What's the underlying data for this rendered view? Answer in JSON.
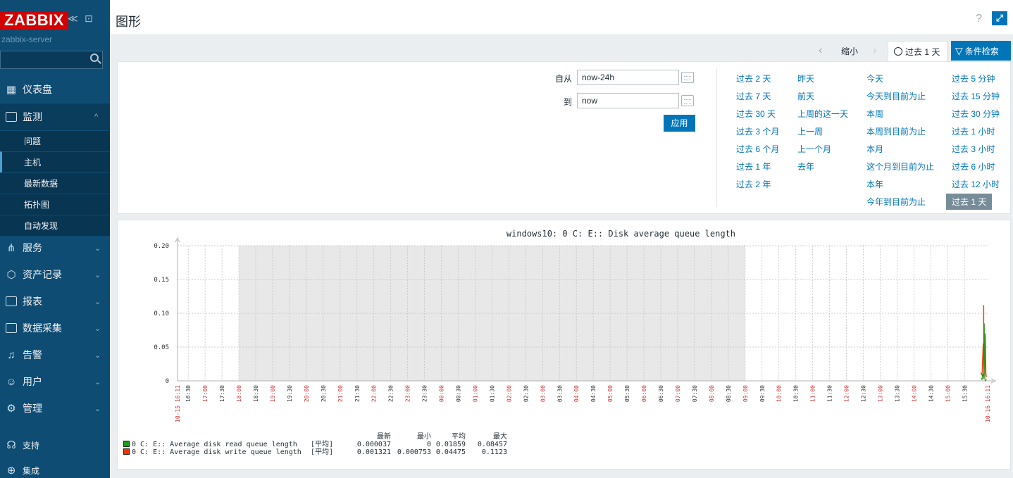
{
  "app": {
    "logo": "ZABBIX",
    "server": "zabbix-server"
  },
  "sidebar": {
    "menu": [
      {
        "label": "仪表盘",
        "icon": "dashboard-icon"
      },
      {
        "label": "监测",
        "icon": "monitor-icon"
      },
      {
        "label": "服务",
        "icon": "services-icon"
      },
      {
        "label": "资产记录",
        "icon": "inventory-icon"
      },
      {
        "label": "报表",
        "icon": "reports-icon"
      },
      {
        "label": "数据采集",
        "icon": "data-collection-icon"
      },
      {
        "label": "告警",
        "icon": "alerts-icon"
      },
      {
        "label": "用户",
        "icon": "users-icon"
      },
      {
        "label": "管理",
        "icon": "administration-icon"
      }
    ],
    "submenu": [
      "问题",
      "主机",
      "最新数据",
      "拓扑图",
      "自动发现"
    ],
    "support": "支持",
    "integrations": "集成"
  },
  "header": {
    "title": "图形",
    "help": "?"
  },
  "timebar": {
    "zoom_out": "缩小",
    "period_tab": "过去 1 天",
    "filter_tab": "条件检索"
  },
  "filter": {
    "from_label": "自从",
    "from_value": "now-24h",
    "to_label": "到",
    "to_value": "now",
    "apply": "应用",
    "quick": [
      [
        "过去 2 天",
        "过去 7 天",
        "过去 30 天",
        "过去 3 个月",
        "过去 6 个月",
        "过去 1 年",
        "过去 2 年"
      ],
      [
        "昨天",
        "前天",
        "上周的这一天",
        "上一周",
        "上一个月",
        "去年"
      ],
      [
        "今天",
        "今天到目前为止",
        "本周",
        "本周到目前为止",
        "本月",
        "这个月到目前为止",
        "本年",
        "今年到目前为止"
      ],
      [
        "过去 5 分钟",
        "过去 15 分钟",
        "过去 30 分钟",
        "过去 1 小时",
        "过去 3 小时",
        "过去 6 小时",
        "过去 12 小时",
        "过去 1 天"
      ]
    ],
    "selected": "过去 1 天"
  },
  "chart_data": {
    "type": "line",
    "title": "windows10: 0 C: E:: Disk average queue length",
    "ylim": [
      0,
      0.2
    ],
    "yticks": [
      "0",
      "0.05",
      "0.10",
      "0.15",
      "0.20"
    ],
    "x_start_label": "10-15 16:11",
    "x_end_label": "10-16 16:11",
    "x_ticks": [
      "16:30",
      "17:00",
      "17:30",
      "18:00",
      "18:30",
      "19:00",
      "19:30",
      "20:00",
      "20:30",
      "21:00",
      "21:30",
      "22:00",
      "22:30",
      "23:00",
      "23:30",
      "00:00",
      "00:30",
      "01:00",
      "01:30",
      "02:00",
      "02:30",
      "03:00",
      "03:30",
      "04:00",
      "04:30",
      "05:00",
      "05:30",
      "06:00",
      "06:30",
      "07:00",
      "07:30",
      "08:00",
      "08:30",
      "09:00",
      "09:30",
      "10:00",
      "10:30",
      "11:00",
      "11:30",
      "12:00",
      "12:30",
      "13:00",
      "13:30",
      "14:00",
      "14:30",
      "15:00",
      "15:30"
    ],
    "grid": true,
    "series": [
      {
        "name": "0 C: E:: Average disk read queue length",
        "color": "#1A9F1A",
        "func": "[平均]",
        "last": "0.000037",
        "min": "0",
        "avg": "0.01859",
        "max": "0.08457"
      },
      {
        "name": "0 C: E:: Average disk write queue length",
        "color": "#F63100",
        "func": "[平均]",
        "last": "0.001321",
        "min": "0.000753",
        "avg": "0.04475",
        "max": "0.1123"
      }
    ],
    "legend_headers": [
      "最新",
      "最小",
      "平均",
      "最大"
    ]
  }
}
